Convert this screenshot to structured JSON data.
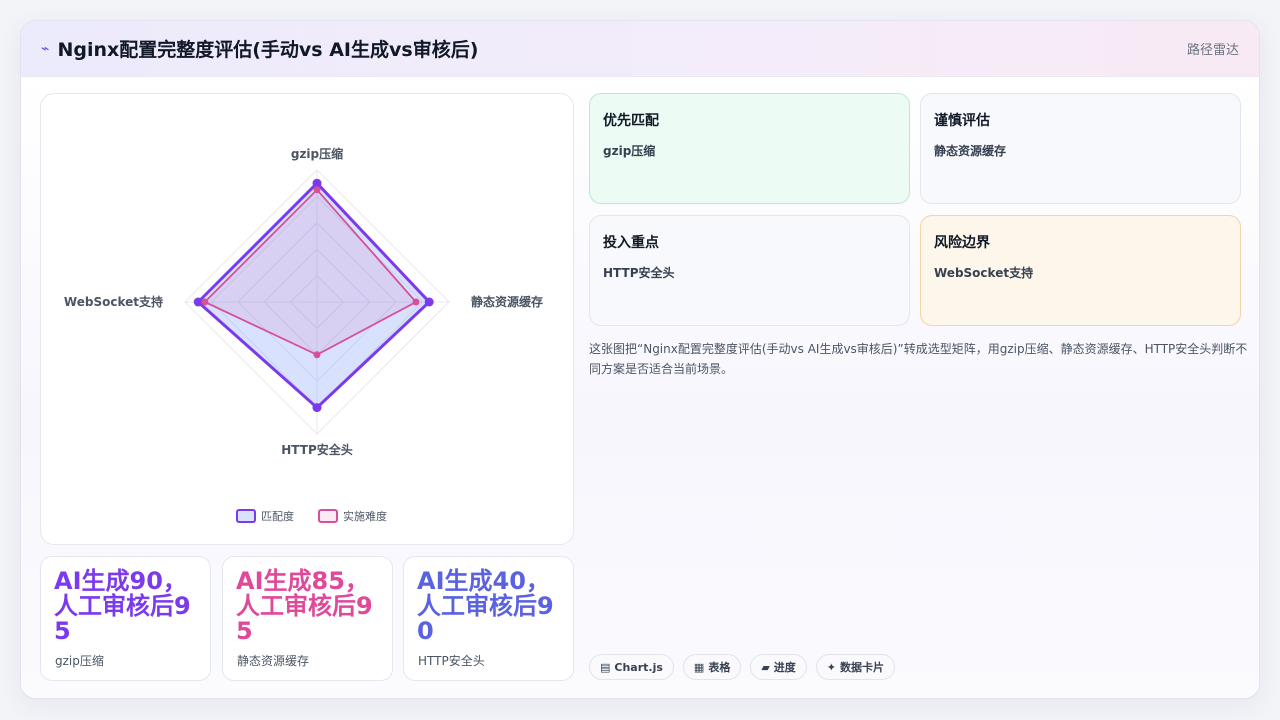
{
  "header": {
    "logo_icon": "⌁",
    "title": "Nginx配置完整度评估(手动vs AI生成vs审核后)",
    "type_label": "路径雷达"
  },
  "chart_data": {
    "type": "radar",
    "axes": [
      "gzip压缩",
      "静态资源缓存",
      "HTTP安全头",
      "WebSocket支持"
    ],
    "range": [
      0,
      100
    ],
    "grid_levels": 5,
    "series": [
      {
        "name": "匹配度",
        "values": [
          90,
          85,
          80,
          90
        ],
        "color": "#7c3aed",
        "fill": "rgba(99,140,255,0.25)"
      },
      {
        "name": "实施难度",
        "values": [
          85,
          75,
          40,
          85
        ],
        "color": "#d6509a",
        "fill": "rgba(214,80,154,0.12)"
      }
    ],
    "legend_position": "bottom"
  },
  "stats": [
    {
      "value": "AI生成90，人工审核后95",
      "label": "gzip压缩",
      "color": "#7c3aed"
    },
    {
      "value": "AI生成85，人工审核后95",
      "label": "静态资源缓存",
      "color": "#e0489a"
    },
    {
      "value": "AI生成40，人工审核后90",
      "label": "HTTP安全头",
      "color": "#5a62e0"
    }
  ],
  "tiles": [
    {
      "title": "优先匹配",
      "value": "gzip压缩",
      "bg": "#ecfbf3",
      "border": "#b7ebcc"
    },
    {
      "title": "谨慎评估",
      "value": "静态资源缓存",
      "bg": "#f8f9fd",
      "border": "#e3e6ef"
    },
    {
      "title": "投入重点",
      "value": "HTTP安全头",
      "bg": "#f8f9fd",
      "border": "#e3e6ef"
    },
    {
      "title": "风险边界",
      "value": "WebSocket支持",
      "bg": "#fdf6ea",
      "border": "#f3d5a9"
    }
  ],
  "description": "这张图把“Nginx配置完整度评估(手动vs AI生成vs审核后)”转成选型矩阵，用gzip压缩、静态资源缓存、HTTP安全头判断不同方案是否适合当前场景。",
  "chips": [
    {
      "icon": "chart-icon",
      "glyph": "▤",
      "label": "Chart.js"
    },
    {
      "icon": "table-icon",
      "glyph": "▦",
      "label": "表格"
    },
    {
      "icon": "progress-icon",
      "glyph": "▰",
      "label": "进度"
    },
    {
      "icon": "sparkle-icon",
      "glyph": "✦",
      "label": "数据卡片"
    }
  ]
}
